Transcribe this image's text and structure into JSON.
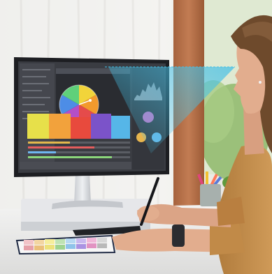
{
  "scene": {
    "description_hidden": "",
    "colors": {
      "wall": "#ecebe8",
      "curtain": "#f4f4f2",
      "window_green": "#9fc27e",
      "wood_frame": "#b5714a",
      "desk": "#ededec",
      "monitor_bezel": "#1d1e22",
      "monitor_stand": "#d6d8dc",
      "skin": "#e2ad8e",
      "hair": "#6e4a2c",
      "jacket": "#c18a48",
      "sight_cone": "#56c5e6"
    },
    "screen_swatches": [
      "#e7e04a",
      "#f2a23c",
      "#e84a3d",
      "#7b53c9",
      "#56b6e8"
    ],
    "palette_card_colors": [
      "#f2c3c7",
      "#f3d5a1",
      "#f5ee9b",
      "#bfe3b3",
      "#b7d9f2",
      "#c9b8ef",
      "#f1b7d8",
      "#d7d7d7"
    ],
    "pencil_colors": [
      "#e0457b",
      "#f1c232",
      "#ff7a59",
      "#5b7bd6"
    ]
  }
}
